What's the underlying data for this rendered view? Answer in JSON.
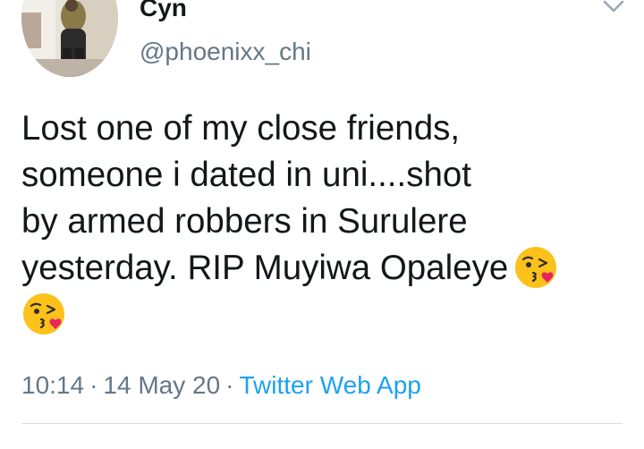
{
  "author": {
    "display_name": "Cyn",
    "handle": "@phoenixx_chi"
  },
  "tweet": {
    "lines": [
      "Lost one of my close friends,",
      "someone i dated in uni....shot",
      "by armed robbers in Surulere",
      "yesterday. RIP Muyiwa Opaleye"
    ],
    "emoji": "face-blowing-a-kiss"
  },
  "meta": {
    "time": "10:14",
    "date": "14 May 20",
    "source": "Twitter Web App",
    "separator": "·"
  },
  "colors": {
    "text": "#14171a",
    "secondary": "#657786",
    "link": "#1da1f2",
    "divider": "#d6dde3"
  }
}
